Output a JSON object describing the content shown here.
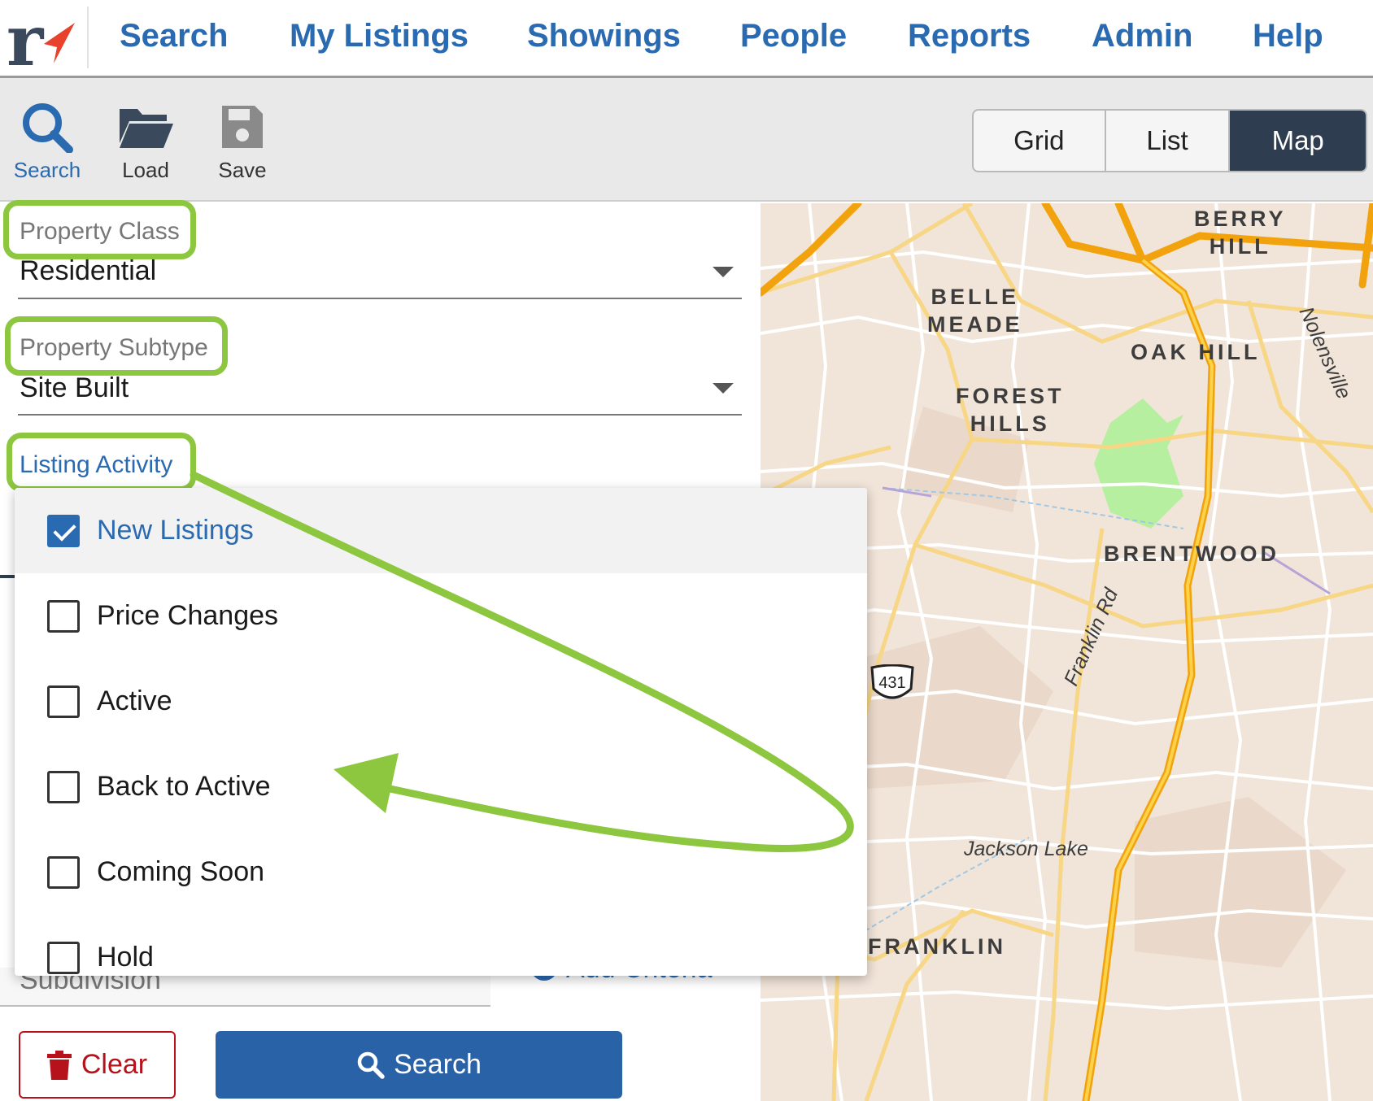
{
  "nav": {
    "logo_icon": "r-logo-with-arrow",
    "items": [
      "Search",
      "My Listings",
      "Showings",
      "People",
      "Reports",
      "Admin",
      "Help"
    ]
  },
  "toolbar": {
    "search": {
      "label": "Search",
      "icon": "search-icon"
    },
    "load": {
      "label": "Load",
      "icon": "folder-open-icon"
    },
    "save": {
      "label": "Save",
      "icon": "save-icon"
    },
    "views": [
      "Grid",
      "List",
      "Map"
    ],
    "active_view": "Map"
  },
  "form": {
    "property_class": {
      "label": "Property Class",
      "value": "Residential"
    },
    "property_subtype": {
      "label": "Property Subtype",
      "value": "Site Built"
    },
    "listing_activity": {
      "label": "Listing Activity"
    },
    "subdivision": {
      "label": "Subdivision"
    },
    "add_criteria_label": "Add Criteria"
  },
  "dropdown": {
    "options": [
      {
        "label": "New Listings",
        "checked": true
      },
      {
        "label": "Price Changes",
        "checked": false
      },
      {
        "label": "Active",
        "checked": false
      },
      {
        "label": "Back to Active",
        "checked": false
      },
      {
        "label": "Coming Soon",
        "checked": false
      },
      {
        "label": "Hold",
        "checked": false
      }
    ]
  },
  "buttons": {
    "clear": "Clear",
    "search": "Search"
  },
  "map": {
    "labels": {
      "berry_hill": "BERRY\nHILL",
      "belle_meade": "BELLE\nMEADE",
      "oak_hill": "OAK HILL",
      "forest_hills": "FOREST\nHILLS",
      "brentwood": "BRENTWOOD",
      "franklin": "FRANKLIN",
      "jackson_lake": "Jackson Lake",
      "franklin_rd": "Franklin Rd",
      "nolensville": "Nolensville",
      "route_431": "431"
    }
  },
  "colors": {
    "brand_blue": "#2a6ab0",
    "active_view_bg": "#2e3d4f",
    "highlight_green": "#8dc63f",
    "clear_red": "#b5121b"
  }
}
